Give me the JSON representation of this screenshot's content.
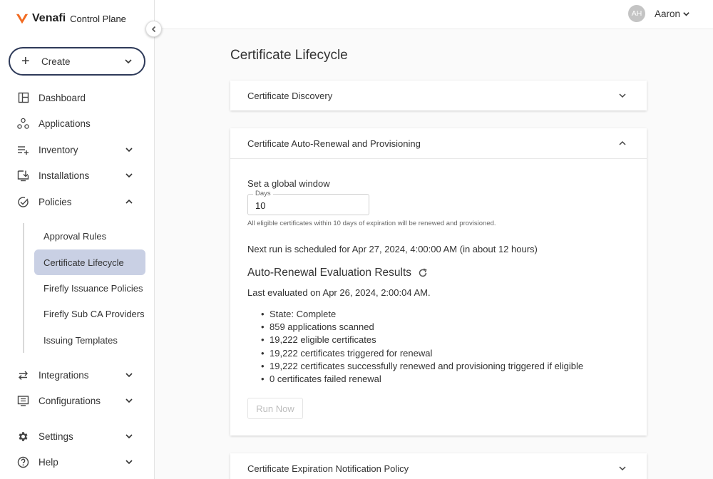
{
  "brand": {
    "name": "Venafi",
    "product": "Control Plane",
    "accent": "#f26b21"
  },
  "create": {
    "label": "Create"
  },
  "nav": {
    "dashboard": "Dashboard",
    "applications": "Applications",
    "inventory": "Inventory",
    "installations": "Installations",
    "policies": "Policies",
    "integrations": "Integrations",
    "configurations": "Configurations",
    "settings": "Settings",
    "help": "Help"
  },
  "policies_sub": {
    "approval_rules": "Approval Rules",
    "certificate_lifecycle": "Certificate Lifecycle",
    "firefly_issuance": "Firefly Issuance Policies",
    "firefly_sub_ca": "Firefly Sub CA Providers",
    "issuing_templates": "Issuing Templates"
  },
  "user": {
    "initials": "AH",
    "name": "Aaron"
  },
  "page": {
    "title": "Certificate Lifecycle"
  },
  "panels": {
    "discovery": "Certificate Discovery",
    "auto_renewal": "Certificate Auto-Renewal and Provisioning",
    "expiration": "Certificate Expiration Notification Policy"
  },
  "auto_renewal": {
    "global_window_label": "Set a global window",
    "days_label": "Days",
    "days_value": "10",
    "hint": "All eligible certificates within 10 days of expiration will be renewed and provisioned.",
    "next_run": "Next run is scheduled for Apr 27, 2024, 4:00:00 AM (in about 12 hours)",
    "results_title": "Auto-Renewal Evaluation Results",
    "last_evaluated": "Last evaluated on Apr 26, 2024, 2:00:04 AM.",
    "results": [
      "State: Complete",
      "859 applications scanned",
      "19,222 eligible certificates",
      "19,222 certificates triggered for renewal",
      "19,222 certificates successfully renewed and provisioning triggered if eligible",
      "0 certificates failed renewal"
    ],
    "run_now": "Run Now"
  }
}
